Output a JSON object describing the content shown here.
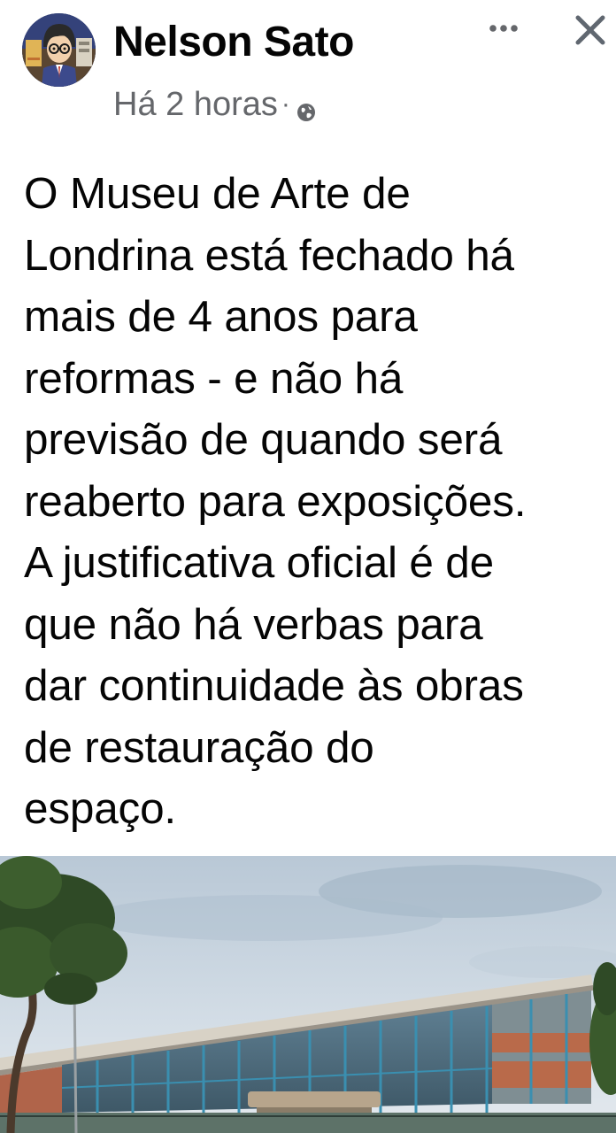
{
  "post": {
    "author": {
      "name": "Nelson Sato",
      "avatar_icon": "cartoon-avatar-icon"
    },
    "timestamp": "Há 2 horas",
    "separator": "·",
    "audience_icon": "globe-icon",
    "menu_icon": "more-options-icon",
    "close_icon": "close-icon",
    "text": "O Museu de Arte de\nLondrina está fechado há\nmais de 4 anos para\nreformas - e não há\nprevisão de quando será\nreaberto para exposições.\nA justificativa oficial é de\nque não há verbas para\ndar continuidade às obras\nde restauração do\nespaço.",
    "photo": {
      "subject": "museum-building-photo"
    }
  },
  "colors": {
    "name_text": "#050505",
    "secondary_text": "#65676b",
    "background": "#ffffff"
  }
}
